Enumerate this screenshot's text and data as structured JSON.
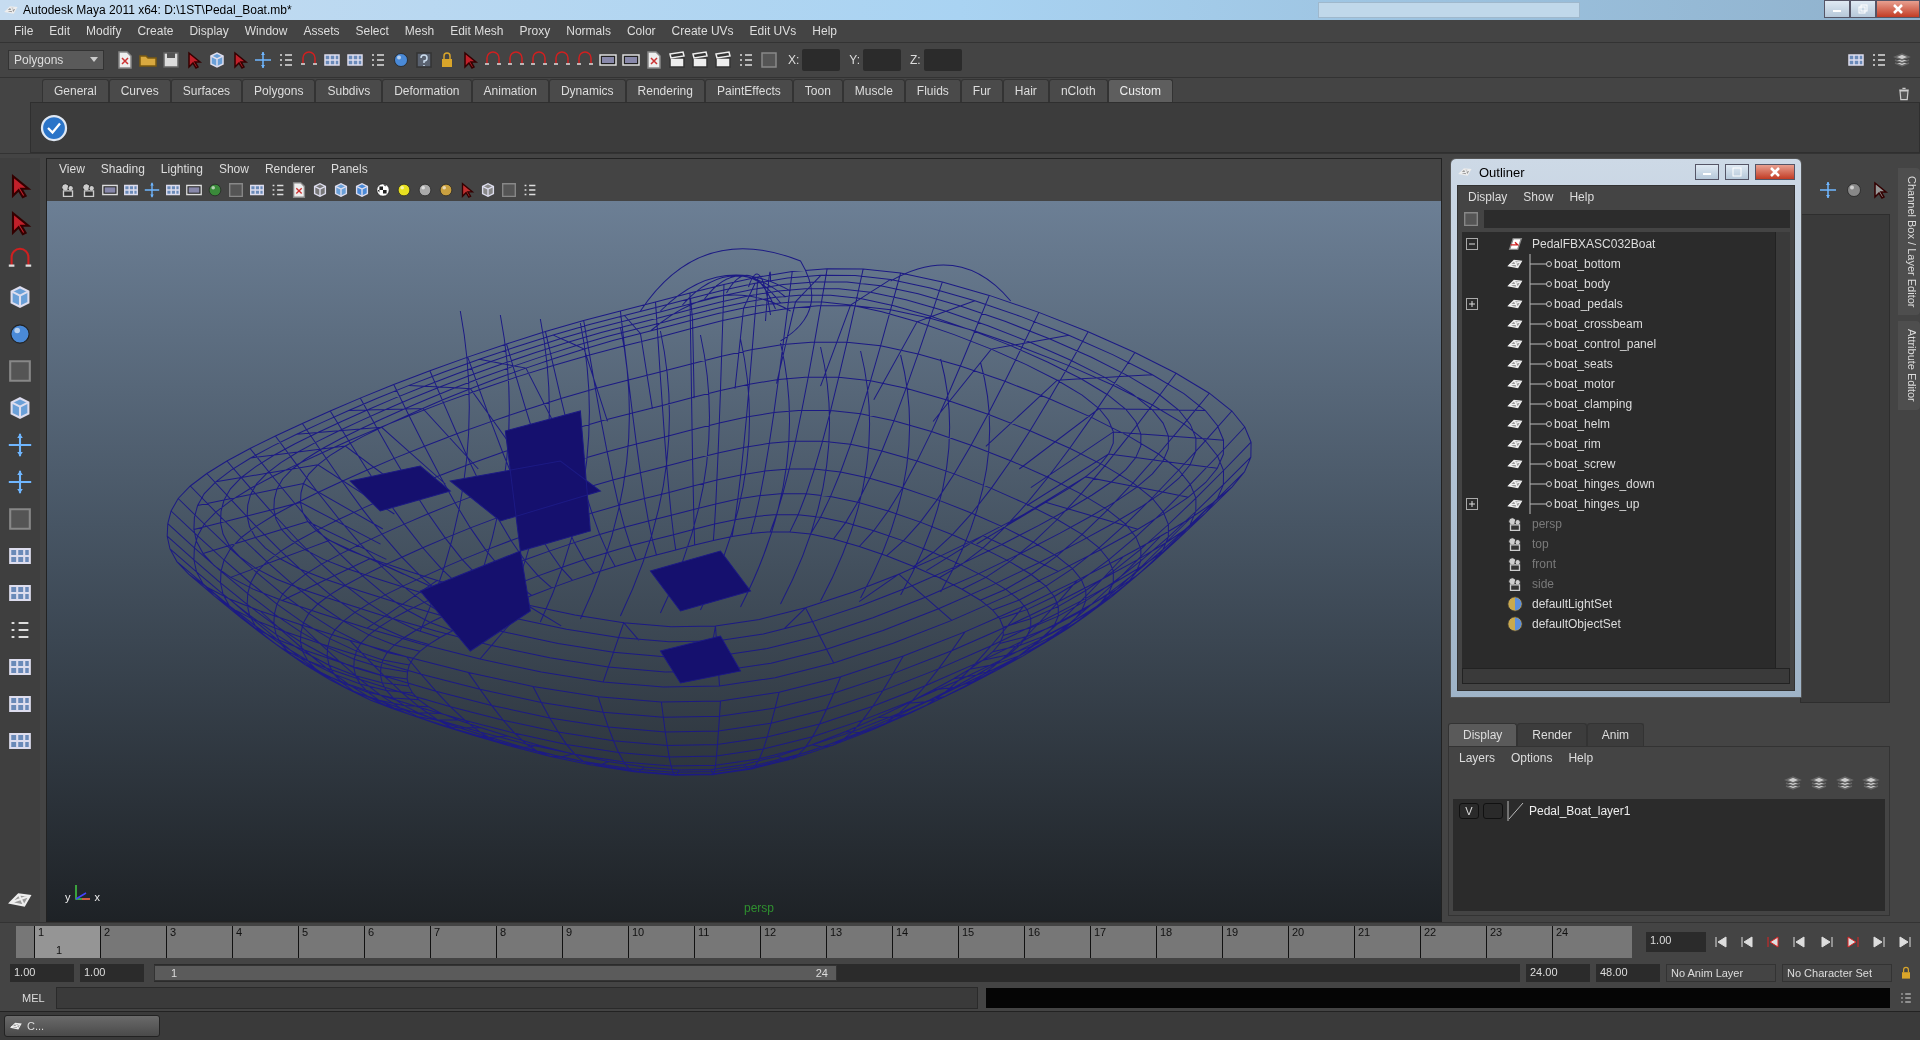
{
  "window": {
    "title": "Autodesk Maya 2011 x64: D:\\1ST\\Pedal_Boat.mb*"
  },
  "menu": [
    "File",
    "Edit",
    "Modify",
    "Create",
    "Display",
    "Window",
    "Assets",
    "Select",
    "Mesh",
    "Edit Mesh",
    "Proxy",
    "Normals",
    "Color",
    "Create UVs",
    "Edit UVs",
    "Help"
  ],
  "toolbar": {
    "mode": "Polygons",
    "coord_labels": [
      "X:",
      "Y:",
      "Z:"
    ]
  },
  "shelf": {
    "tabs": [
      {
        "label": "General",
        "selected": false
      },
      {
        "label": "Curves",
        "selected": false
      },
      {
        "label": "Surfaces",
        "selected": false
      },
      {
        "label": "Polygons",
        "selected": false
      },
      {
        "label": "Subdivs",
        "selected": false
      },
      {
        "label": "Deformation",
        "selected": false
      },
      {
        "label": "Animation",
        "selected": false
      },
      {
        "label": "Dynamics",
        "selected": false
      },
      {
        "label": "Rendering",
        "selected": false
      },
      {
        "label": "PaintEffects",
        "selected": false
      },
      {
        "label": "Toon",
        "selected": false
      },
      {
        "label": "Muscle",
        "selected": false
      },
      {
        "label": "Fluids",
        "selected": false
      },
      {
        "label": "Fur",
        "selected": false
      },
      {
        "label": "Hair",
        "selected": false
      },
      {
        "label": "nCloth",
        "selected": false
      },
      {
        "label": "Custom",
        "selected": true
      }
    ]
  },
  "viewport": {
    "menu": [
      "View",
      "Shading",
      "Lighting",
      "Show",
      "Renderer",
      "Panels"
    ],
    "camera": "persp",
    "axes": [
      "y",
      "x"
    ]
  },
  "outliner": {
    "title": "Outliner",
    "menu": [
      "Display",
      "Show",
      "Help"
    ],
    "items": [
      {
        "label": "PedalFBXASC032Boat",
        "kind": "group",
        "dimmed": false,
        "expanded": true,
        "children": [
          {
            "label": "boat_bottom",
            "has_children": false
          },
          {
            "label": "boat_body",
            "has_children": false
          },
          {
            "label": "boad_pedals",
            "has_children": true
          },
          {
            "label": "boat_crossbeam",
            "has_children": false
          },
          {
            "label": "boat_control_panel",
            "has_children": false
          },
          {
            "label": "boat_seats",
            "has_children": false
          },
          {
            "label": "boat_motor",
            "has_children": false
          },
          {
            "label": "boat_clamping",
            "has_children": false
          },
          {
            "label": "boat_helm",
            "has_children": false
          },
          {
            "label": "boat_rim",
            "has_children": false
          },
          {
            "label": "boat_screw",
            "has_children": false
          },
          {
            "label": "boat_hinges_down",
            "has_children": false
          },
          {
            "label": "boat_hinges_up",
            "has_children": true
          }
        ]
      },
      {
        "label": "persp",
        "kind": "camera",
        "dimmed": true
      },
      {
        "label": "top",
        "kind": "camera",
        "dimmed": true
      },
      {
        "label": "front",
        "kind": "camera",
        "dimmed": true
      },
      {
        "label": "side",
        "kind": "camera",
        "dimmed": true
      },
      {
        "label": "defaultLightSet",
        "kind": "set",
        "dimmed": false
      },
      {
        "label": "defaultObjectSet",
        "kind": "set",
        "dimmed": false
      }
    ]
  },
  "side_tabs": [
    "Channel Box / Layer Editor",
    "Attribute Editor"
  ],
  "layer_editor": {
    "tabs": [
      {
        "label": "Display",
        "selected": true
      },
      {
        "label": "Render",
        "selected": false
      },
      {
        "label": "Anim",
        "selected": false
      }
    ],
    "menu": [
      "Layers",
      "Options",
      "Help"
    ],
    "layers": [
      {
        "visibility": "V",
        "name": "Pedal_Boat_layer1"
      }
    ]
  },
  "timeline": {
    "ticks": [
      {
        "label": "1",
        "selected": true
      },
      {
        "label": "2",
        "selected": false
      },
      {
        "label": "3",
        "selected": false
      },
      {
        "label": "4",
        "selected": false
      },
      {
        "label": "5",
        "selected": false
      },
      {
        "label": "6",
        "selected": false
      },
      {
        "label": "7",
        "selected": false
      },
      {
        "label": "8",
        "selected": false
      },
      {
        "label": "9",
        "selected": false
      },
      {
        "label": "10",
        "selected": false
      },
      {
        "label": "11",
        "selected": false
      },
      {
        "label": "12",
        "selected": false
      },
      {
        "label": "13",
        "selected": false
      },
      {
        "label": "14",
        "selected": false
      },
      {
        "label": "15",
        "selected": false
      },
      {
        "label": "16",
        "selected": false
      },
      {
        "label": "17",
        "selected": false
      },
      {
        "label": "18",
        "selected": false
      },
      {
        "label": "19",
        "selected": false
      },
      {
        "label": "20",
        "selected": false
      },
      {
        "label": "21",
        "selected": false
      },
      {
        "label": "22",
        "selected": false
      },
      {
        "label": "23",
        "selected": false
      },
      {
        "label": "24",
        "selected": false
      }
    ],
    "current_frame": "1",
    "current_time": "1.00"
  },
  "range": {
    "level": 0.5,
    "start": "1.00",
    "playback_start": "1.00",
    "slider_start": "1",
    "slider_end": "24",
    "playback_end": "24.00",
    "end": "48.00",
    "anim_layer": "No Anim Layer",
    "character_set": "No Character Set"
  },
  "command_line": {
    "label": "MEL"
  },
  "taskbar": {
    "label": "C..."
  }
}
